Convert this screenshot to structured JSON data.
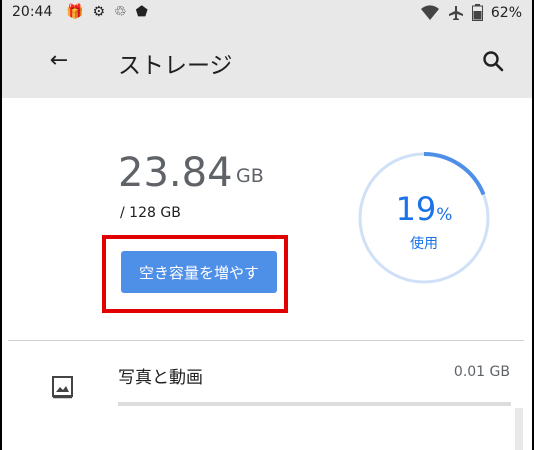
{
  "status_bar": {
    "time": "20:44",
    "battery": "62%",
    "left_icons": [
      "gift-icon",
      "gear-icon",
      "recycle-icon",
      "shield-icon"
    ],
    "right_icons": [
      "wifi-icon",
      "airplane-icon",
      "battery-icon"
    ]
  },
  "app_bar": {
    "title": "ストレージ",
    "back_icon": "arrow-left-icon",
    "search_icon": "search-icon"
  },
  "storage": {
    "used_value": "23.84",
    "used_unit": "GB",
    "total": "/ 128 GB",
    "percent_value": "19",
    "percent_symbol": "%",
    "percent_fraction": 0.19,
    "used_label": "使用",
    "free_up_button": "空き容量を増やす"
  },
  "categories": [
    {
      "label": "写真と動画",
      "size": "0.01 GB",
      "fill_fraction": 0.0,
      "icon": "photo-icon"
    }
  ],
  "colors": {
    "accent": "#4e8fe8",
    "percent_text": "#1a73e8",
    "highlight": "#e00000",
    "ring_track": "#cfe0f7"
  }
}
